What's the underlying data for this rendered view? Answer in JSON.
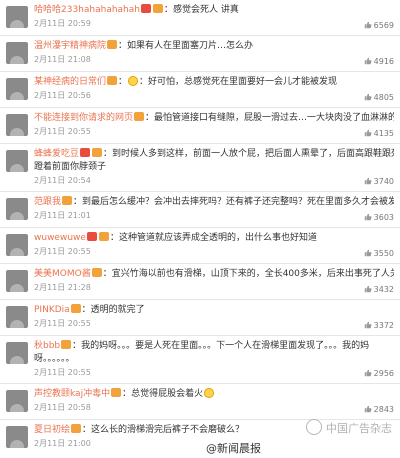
{
  "comments": [
    {
      "user": "哈哈哈233hahahahahah",
      "badge": "★",
      "text": "：感觉会死人 讲真",
      "time": "2月11日 20:59",
      "likes": "6569",
      "emoji": false
    },
    {
      "user": "温州瀑宇精神病院",
      "badge": "",
      "text": "：如果有人在里面塞刀片…怎么办",
      "time": "2月11日 21:08",
      "likes": "4916",
      "emoji": false
    },
    {
      "user": "某神经病的日常们",
      "badge": "",
      "text": "：好可怕，总感觉死在里面要好一会儿才能被发现",
      "time": "2月11日 20:56",
      "likes": "4805",
      "emoji": true
    },
    {
      "user": "不能连接到你请求的网页",
      "badge": "",
      "text": "：最怕管道接口有缝隙，屁股一滑过去…一大块肉没了血淋淋的",
      "time": "2月11日 20:55",
      "likes": "4135",
      "emoji": false
    },
    {
      "user": "蜂蜂爱吃豆",
      "badge": "★",
      "text": "：到时候人多到这样，前面一人放个屁，把后面人熏晕了，后面高跟鞋跟死命",
      "text2": "蹬着前面你脖颈子",
      "time": "2月11日 20:54",
      "likes": "3740",
      "emoji": false
    },
    {
      "user": "范跟我",
      "badge": "",
      "text": "：到最后怎么缓冲？会冲出去摔死吗？还有裤子还完整吗？死在里面多久才会被发现？",
      "time": "2月11日 21:01",
      "likes": "3603",
      "emoji": false
    },
    {
      "user": "wuwewuwe",
      "badge": "★",
      "text": "：这种管道就应该弄成全透明的，出什么事也好知道",
      "time": "2月11日 20:55",
      "likes": "3550",
      "emoji": false
    },
    {
      "user": "美美MOMO酱",
      "badge": "",
      "text": "：宜兴竹海以前也有滑梯，山顶下来的，全长400多米，后来出事死了人关闭了。",
      "time": "2月11日 21:28",
      "likes": "3432",
      "emoji": false
    },
    {
      "user": "PINKDia",
      "badge": "",
      "text": "：透明的就完了",
      "time": "2月11日 20:55",
      "likes": "3372",
      "emoji": false
    },
    {
      "user": "秋bbb",
      "badge": "",
      "text": "：我的妈呀。。。要是人死在里面。。。下一个人在滑梯里面发现了。。。我的妈",
      "text2": "呀。。。。。。",
      "time": "2月11日 20:55",
      "likes": "2956",
      "emoji": false
    },
    {
      "user": "声控教颐kaj冲毒中",
      "badge": "",
      "text": "：总觉得屁股会着火",
      "time": "2月11日 20:58",
      "likes": "2843",
      "emoji": true
    },
    {
      "user": "夏日初绘",
      "badge": "",
      "text": "：这么长的滑梯滑完后裤子不会磨破么？",
      "time": "2月11日 21:00",
      "likes": "",
      "emoji": false
    }
  ],
  "watermark": "中国广告杂志",
  "footer_handle": "@新闻晨报",
  "colors": {
    "username": "#eb7350",
    "time": "#9a9a9a"
  }
}
